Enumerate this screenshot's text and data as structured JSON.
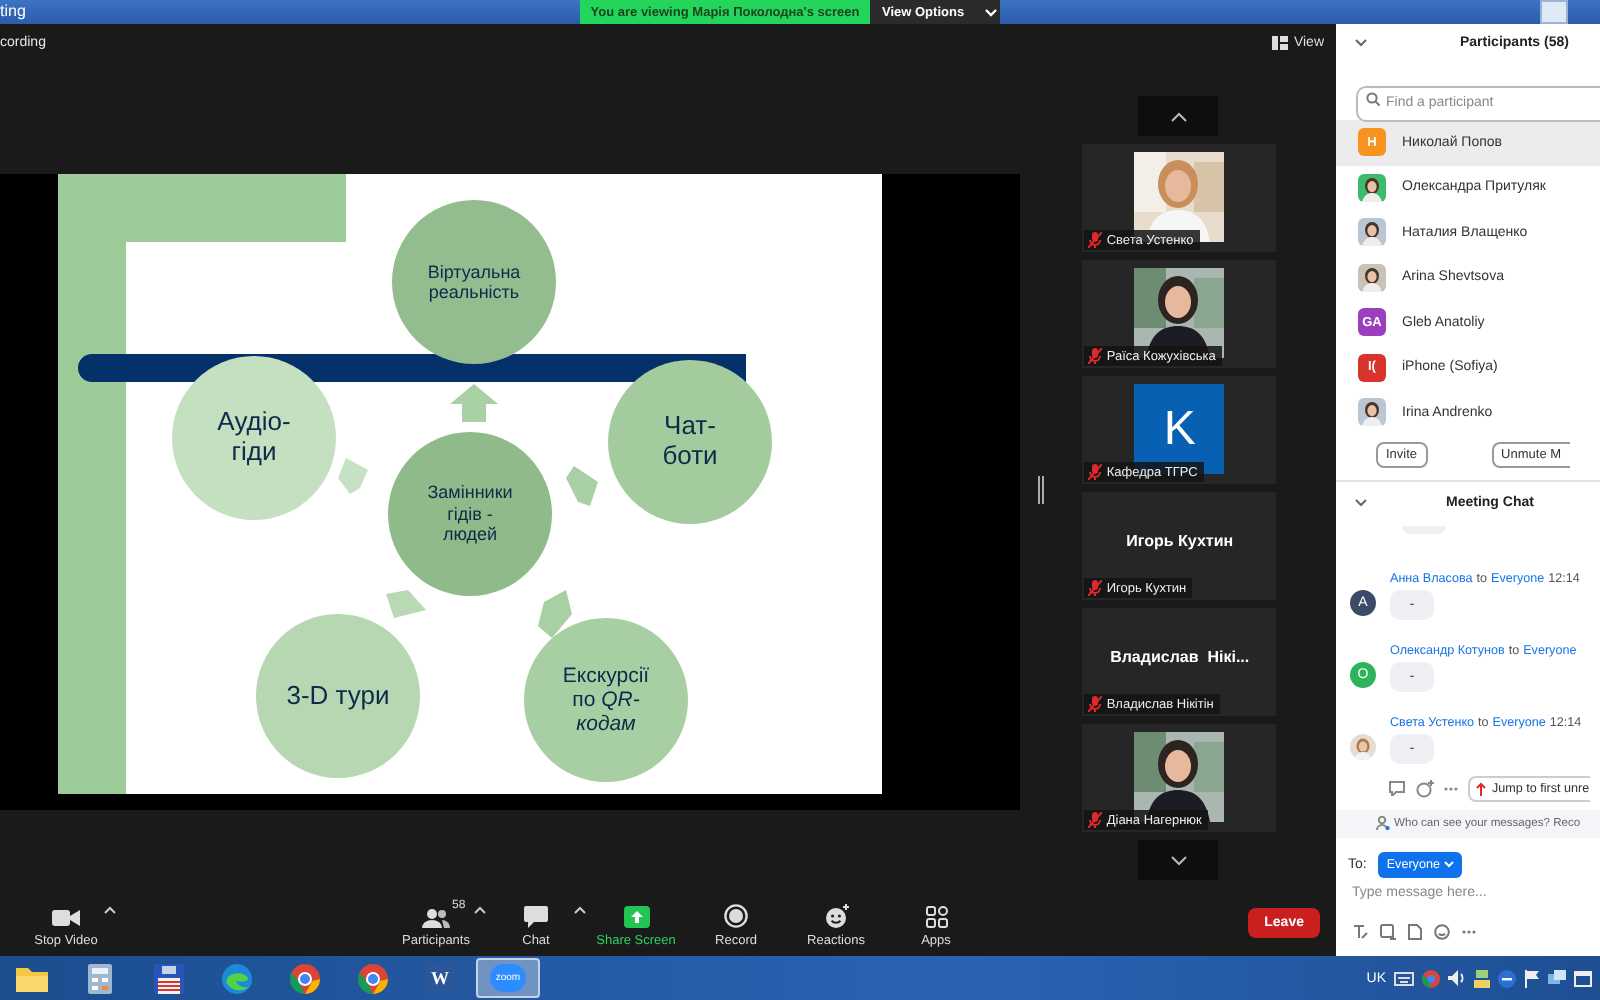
{
  "window": {
    "title": "ting"
  },
  "share_banner": {
    "text": "You are viewing Марія Поколодна's screen",
    "button": "View Options"
  },
  "meeting_bar": {
    "recording": "cording",
    "view_button": "View"
  },
  "slide": {
    "nodes": [
      {
        "text": "Віртуальна\nреальність",
        "color": "#93bd8e",
        "kind": "small"
      },
      {
        "text": "Аудіо-\nгіди",
        "color": "#c4e0c1",
        "kind": "large"
      },
      {
        "text": "Чат-\nботи",
        "color": "#a3cb9e",
        "kind": "large"
      },
      {
        "text": "Замінники\nгідів -\nлюдей",
        "color": "#8fba89",
        "kind": "small"
      },
      {
        "text": "3-D тури",
        "color": "#b6d7b2",
        "kind": "large"
      },
      {
        "text": "Екскурсії\nпо *QR-\nкодам*",
        "color": "#a8cea3",
        "kind": "medium"
      }
    ]
  },
  "video_tiles": [
    {
      "name": "Света Устенко",
      "kind": "picture",
      "muted": true
    },
    {
      "name": "Раїса Кожухівська",
      "kind": "picture",
      "muted": true
    },
    {
      "name": "Кафедра ТГРС",
      "kind": "letter",
      "letter": "K",
      "muted": true
    },
    {
      "name": "Игорь Кухтин",
      "kind": "name",
      "display": "Игорь Кухтин",
      "muted": true
    },
    {
      "name": "Владислав Нікітін",
      "kind": "name",
      "display": "Владислав  Нікі...",
      "muted": true
    },
    {
      "name": "Діана Нагернюк",
      "kind": "picture",
      "muted": true
    }
  ],
  "participants": {
    "title": "Participants (58)",
    "search": {
      "placeholder": "Find a participant"
    },
    "items": [
      {
        "name": "Николай Попов",
        "kind": "initials",
        "initials": "H",
        "color": "#f7931e",
        "selected": true
      },
      {
        "name": "Олександра Притуляк",
        "kind": "picture",
        "selected": false
      },
      {
        "name": "Наталия Влащенко",
        "kind": "picture",
        "selected": false
      },
      {
        "name": "Arina Shevtsova",
        "kind": "picture",
        "selected": false
      },
      {
        "name": "Gleb Anatoliy",
        "kind": "initials",
        "initials": "GA",
        "color": "#9b3fbf",
        "selected": false
      },
      {
        "name": "iPhone (Sofiya)",
        "kind": "initials",
        "initials": "I(",
        "color": "#d8342c",
        "selected": false
      },
      {
        "name": "Irina Andrenko",
        "kind": "picture",
        "selected": false
      }
    ],
    "buttons": [
      "Invite",
      "Unmute M"
    ]
  },
  "chat": {
    "title": "Meeting Chat",
    "messages": [
      {
        "sender": "Анна Власова",
        "to": "to",
        "recipient": "Everyone",
        "time": "12:14",
        "text": "-",
        "kind": "initials",
        "initials": "A",
        "color": "#3b4a66"
      },
      {
        "sender": "Олександр Котунов",
        "to": "to",
        "recipient": "Everyone",
        "text": "-",
        "kind": "initials",
        "initials": "O",
        "color": "#2db35a"
      },
      {
        "sender": "Света Устенко",
        "to": "to",
        "recipient": "Everyone",
        "time": "12:14",
        "text": "-",
        "kind": "picture"
      }
    ],
    "jump_button": "Jump to first unre",
    "privacy_note": "Who can see your messages? Reco",
    "to_label": "To:",
    "recipient": "Everyone",
    "input": {
      "placeholder": "Type message here..."
    }
  },
  "toolbar": {
    "items": [
      {
        "kind": "video",
        "label": "Stop Video",
        "caret": true
      },
      {
        "kind": "participants",
        "label": "Participants",
        "count": "58",
        "caret": true
      },
      {
        "kind": "chat",
        "label": "Chat",
        "caret": true
      },
      {
        "kind": "share",
        "label": "Share Screen",
        "caret": false
      },
      {
        "kind": "record",
        "label": "Record",
        "caret": false
      },
      {
        "kind": "reactions",
        "label": "Reactions",
        "caret": false
      },
      {
        "kind": "apps",
        "label": "Apps",
        "caret": false
      }
    ],
    "leave": "Leave"
  },
  "taskbar": {
    "apps": [
      {
        "kind": "folder",
        "selected": false
      },
      {
        "kind": "calculator",
        "selected": false
      },
      {
        "kind": "floppy",
        "selected": false
      },
      {
        "kind": "edge",
        "selected": false
      },
      {
        "kind": "chrome",
        "selected": false
      },
      {
        "kind": "chrome",
        "selected": false
      },
      {
        "kind": "word",
        "text": "W",
        "selected": false
      },
      {
        "kind": "zoom",
        "text": "zoom",
        "selected": true
      }
    ],
    "language": "UK"
  }
}
